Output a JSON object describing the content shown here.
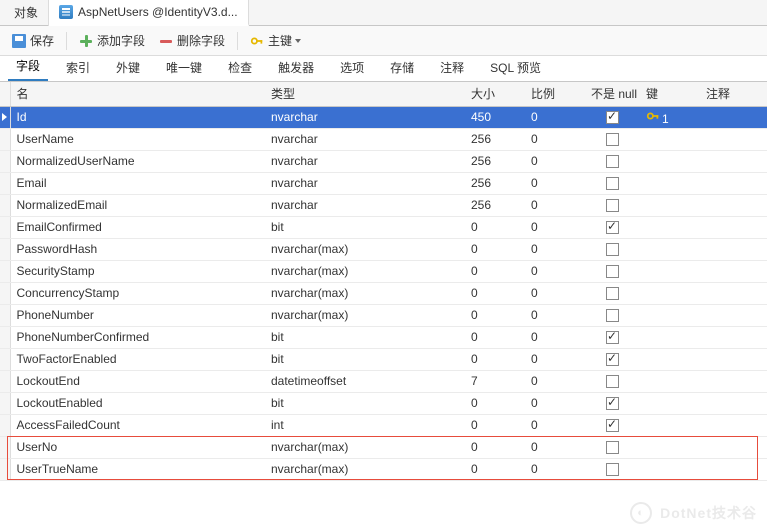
{
  "titlebar": {
    "tabs": [
      {
        "label": "对象"
      },
      {
        "label": "AspNetUsers @IdentityV3.d..."
      }
    ],
    "activeIndex": 1
  },
  "toolbar": {
    "save": "保存",
    "addField": "添加字段",
    "deleteField": "删除字段",
    "primaryKey": "主键"
  },
  "subtabs": {
    "items": [
      "字段",
      "索引",
      "外键",
      "唯一键",
      "检查",
      "触发器",
      "选项",
      "存储",
      "注释",
      "SQL 预览"
    ],
    "activeIndex": 0
  },
  "gridHeaders": {
    "name": "名",
    "type": "类型",
    "size": "大小",
    "scale": "比例",
    "notNull": "不是 null",
    "key": "键",
    "comment": "注释"
  },
  "rows": [
    {
      "name": "Id",
      "type": "nvarchar",
      "size": "450",
      "scale": "0",
      "notNull": true,
      "key": "1"
    },
    {
      "name": "UserName",
      "type": "nvarchar",
      "size": "256",
      "scale": "0",
      "notNull": false,
      "key": ""
    },
    {
      "name": "NormalizedUserName",
      "type": "nvarchar",
      "size": "256",
      "scale": "0",
      "notNull": false,
      "key": ""
    },
    {
      "name": "Email",
      "type": "nvarchar",
      "size": "256",
      "scale": "0",
      "notNull": false,
      "key": ""
    },
    {
      "name": "NormalizedEmail",
      "type": "nvarchar",
      "size": "256",
      "scale": "0",
      "notNull": false,
      "key": ""
    },
    {
      "name": "EmailConfirmed",
      "type": "bit",
      "size": "0",
      "scale": "0",
      "notNull": true,
      "key": ""
    },
    {
      "name": "PasswordHash",
      "type": "nvarchar(max)",
      "size": "0",
      "scale": "0",
      "notNull": false,
      "key": ""
    },
    {
      "name": "SecurityStamp",
      "type": "nvarchar(max)",
      "size": "0",
      "scale": "0",
      "notNull": false,
      "key": ""
    },
    {
      "name": "ConcurrencyStamp",
      "type": "nvarchar(max)",
      "size": "0",
      "scale": "0",
      "notNull": false,
      "key": ""
    },
    {
      "name": "PhoneNumber",
      "type": "nvarchar(max)",
      "size": "0",
      "scale": "0",
      "notNull": false,
      "key": ""
    },
    {
      "name": "PhoneNumberConfirmed",
      "type": "bit",
      "size": "0",
      "scale": "0",
      "notNull": true,
      "key": ""
    },
    {
      "name": "TwoFactorEnabled",
      "type": "bit",
      "size": "0",
      "scale": "0",
      "notNull": true,
      "key": ""
    },
    {
      "name": "LockoutEnd",
      "type": "datetimeoffset",
      "size": "7",
      "scale": "0",
      "notNull": false,
      "key": ""
    },
    {
      "name": "LockoutEnabled",
      "type": "bit",
      "size": "0",
      "scale": "0",
      "notNull": true,
      "key": ""
    },
    {
      "name": "AccessFailedCount",
      "type": "int",
      "size": "0",
      "scale": "0",
      "notNull": true,
      "key": ""
    },
    {
      "name": "UserNo",
      "type": "nvarchar(max)",
      "size": "0",
      "scale": "0",
      "notNull": false,
      "key": ""
    },
    {
      "name": "UserTrueName",
      "type": "nvarchar(max)",
      "size": "0",
      "scale": "0",
      "notNull": false,
      "key": ""
    }
  ],
  "selectedRowIndex": 0,
  "highlightRows": {
    "start": 15,
    "count": 2
  },
  "watermark": "DotNet技术谷"
}
